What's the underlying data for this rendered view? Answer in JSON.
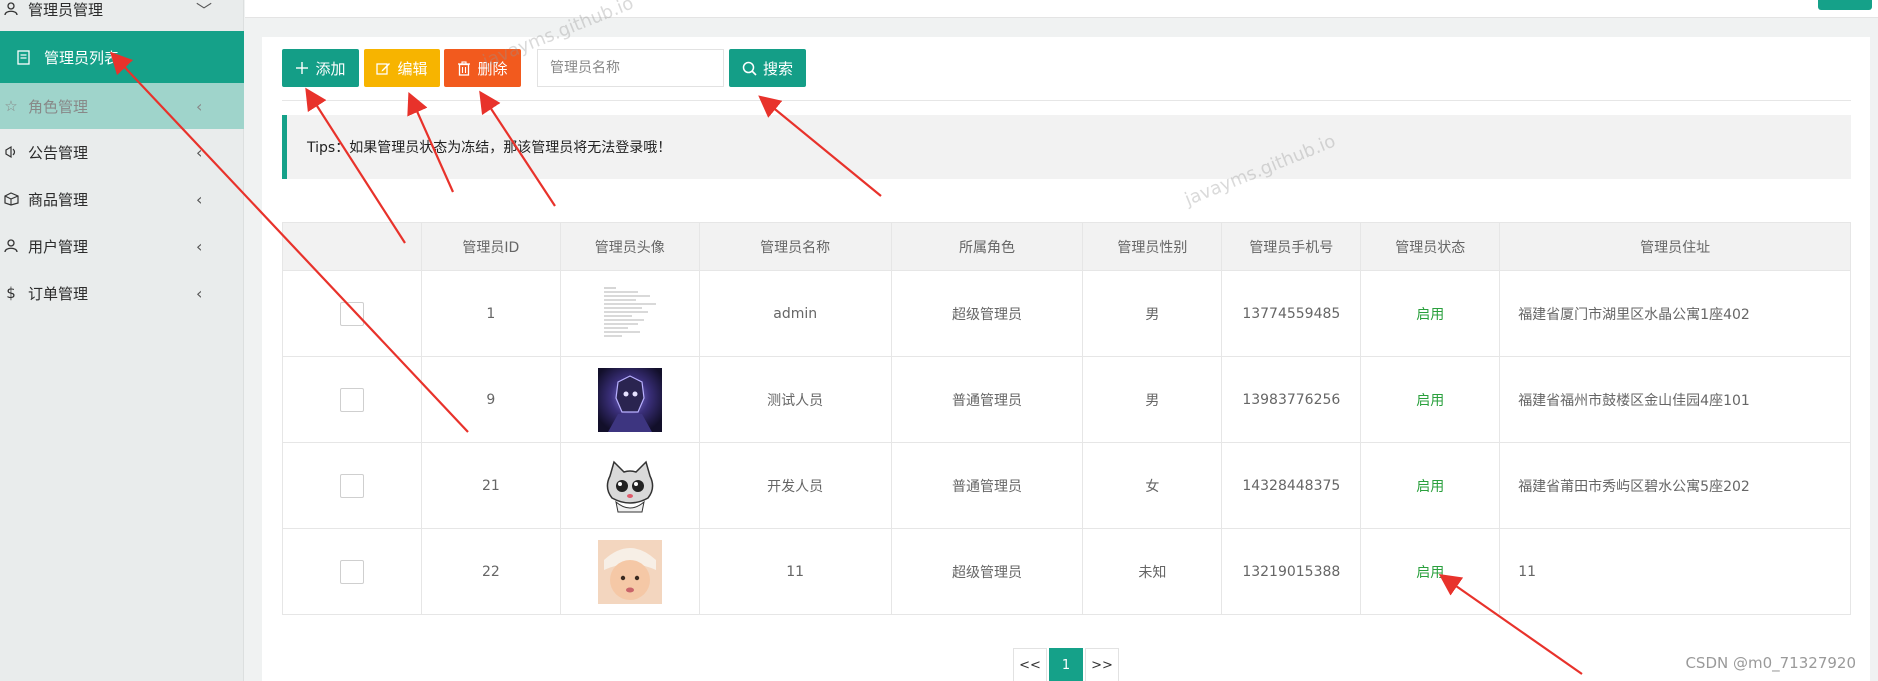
{
  "sidebar": {
    "items": [
      {
        "label": "管理员管理",
        "icon": "user-admin-icon",
        "chevron": "﹀"
      },
      {
        "label": "管理员列表",
        "icon": "list-icon"
      },
      {
        "label": "角色管理",
        "icon": "star-icon",
        "chevron": "‹"
      },
      {
        "label": "公告管理",
        "icon": "announce-icon",
        "chevron": "‹"
      },
      {
        "label": "商品管理",
        "icon": "goods-icon",
        "chevron": "‹"
      },
      {
        "label": "用户管理",
        "icon": "user-icon",
        "chevron": "‹"
      },
      {
        "label": "订单管理",
        "icon": "dollar-icon",
        "chevron": "‹"
      }
    ]
  },
  "toolbar": {
    "add_label": "添加",
    "edit_label": "编辑",
    "delete_label": "删除",
    "search_placeholder": "管理员名称",
    "search_label": "搜索"
  },
  "tips": "Tips：如果管理员状态为冻结，那该管理员将无法登录哦！",
  "table": {
    "headers": [
      "",
      "管理员ID",
      "管理员头像",
      "管理员名称",
      "所属角色",
      "管理员性别",
      "管理员手机号",
      "管理员状态",
      "管理员住址"
    ],
    "rows": [
      {
        "id": "1",
        "avatar": "document-thumbnail",
        "name": "admin",
        "role": "超级管理员",
        "gender": "男",
        "phone": "13774559485",
        "status": "启用",
        "address": "福建省厦门市湖里区水晶公寓1座402"
      },
      {
        "id": "9",
        "avatar": "armored-hero-image",
        "name": "测试人员",
        "role": "普通管理员",
        "gender": "男",
        "phone": "13983776256",
        "status": "启用",
        "address": "福建省福州市鼓楼区金山佳园4座101"
      },
      {
        "id": "21",
        "avatar": "cartoon-cat-image",
        "name": "开发人员",
        "role": "普通管理员",
        "gender": "女",
        "phone": "14328448375",
        "status": "启用",
        "address": "福建省莆田市秀屿区碧水公寓5座202"
      },
      {
        "id": "22",
        "avatar": "baby-photo-image",
        "name": "11",
        "role": "超级管理员",
        "gender": "未知",
        "phone": "13219015388",
        "status": "启用",
        "address": "11"
      }
    ]
  },
  "pager": {
    "prev": "<<",
    "current": "1",
    "next": ">>"
  },
  "watermark": "javayms.github.io",
  "footer_credit": "CSDN @m0_71327920",
  "colors": {
    "primary": "#15a189",
    "warning": "#f7b400",
    "danger": "#f25a1e",
    "status_ok": "#2aa03d",
    "annotation": "#e8322b"
  }
}
